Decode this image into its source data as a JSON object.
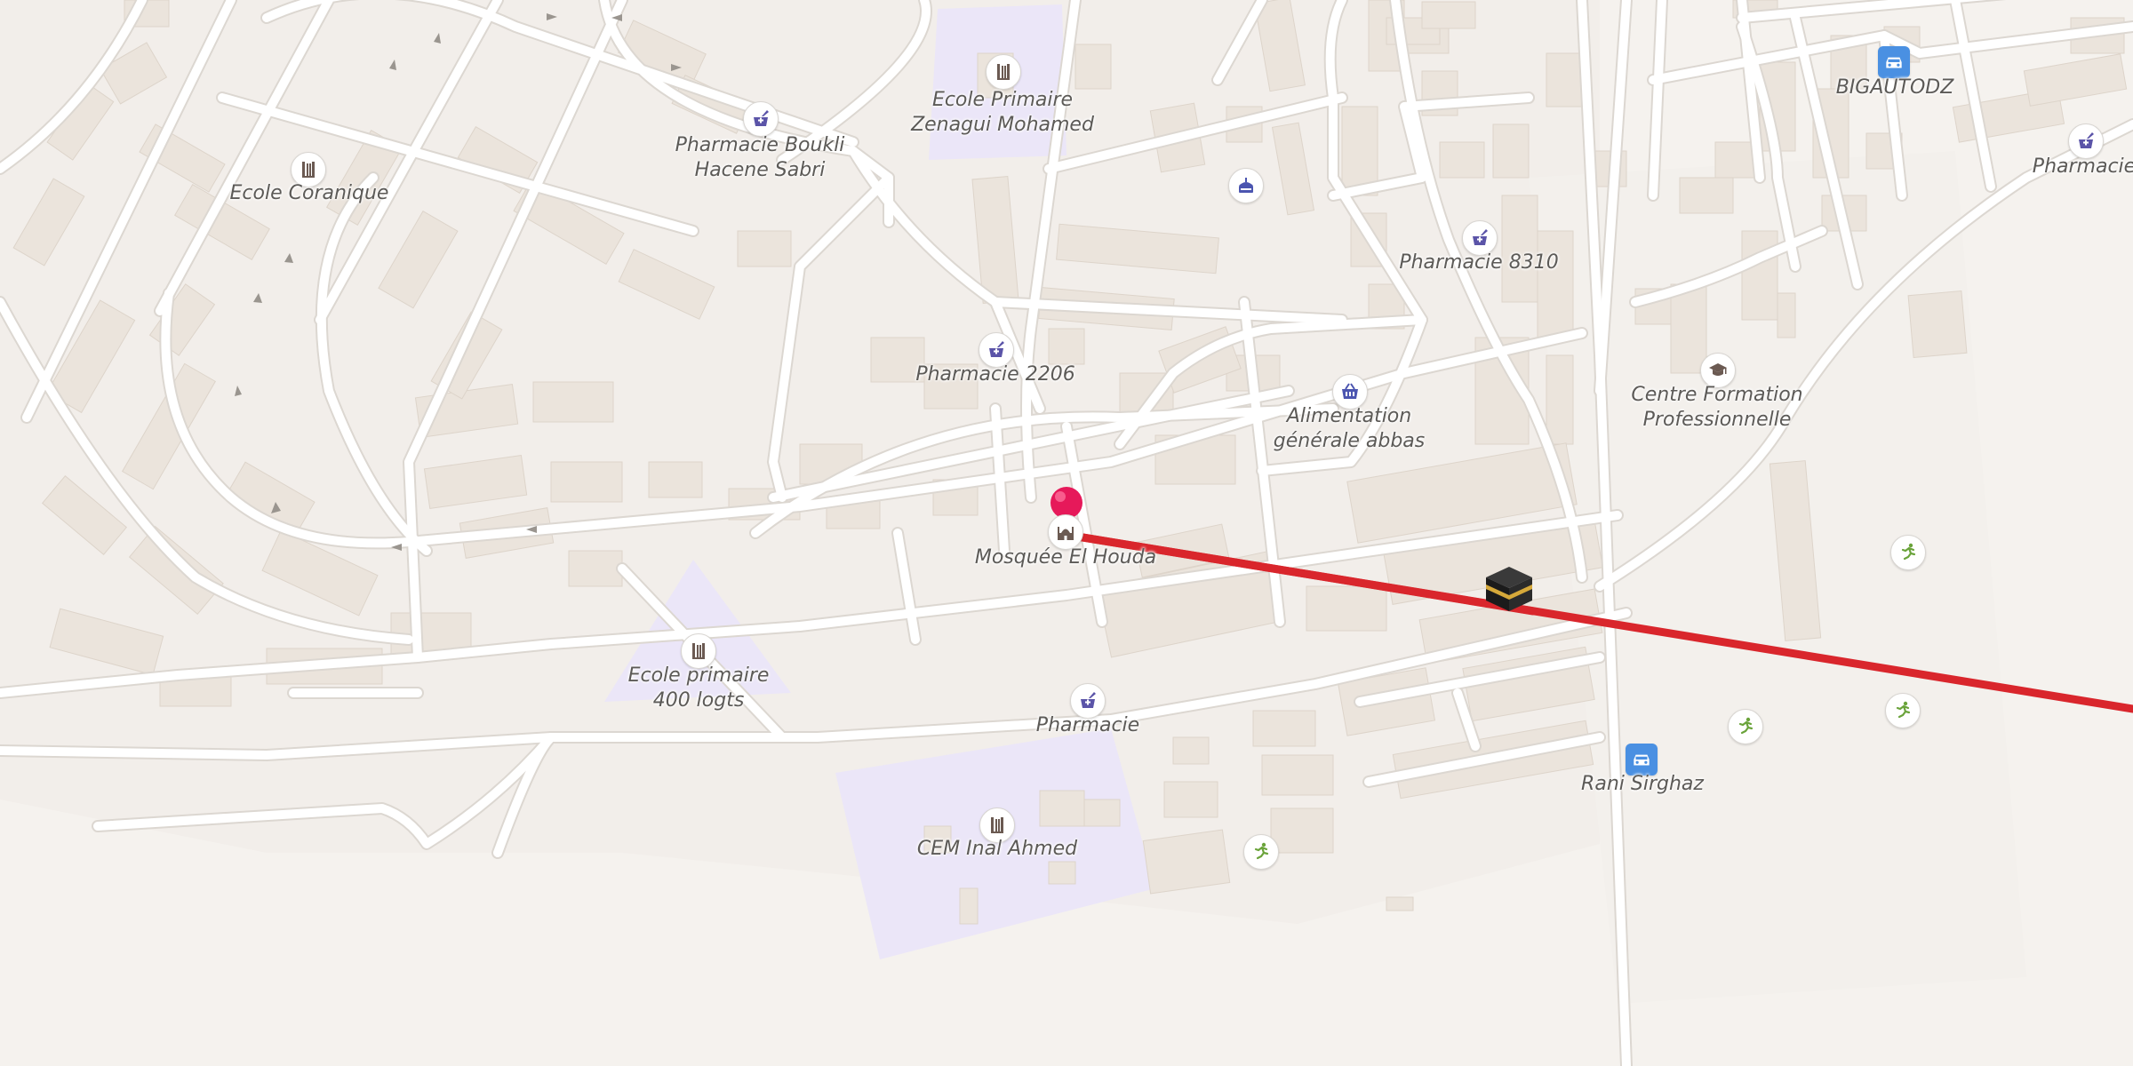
{
  "map": {
    "route_color": "#d9262c",
    "pin_color": "#e6195a",
    "education_area_color": "#ebe6f8",
    "building_color": "#ebe4dc",
    "road_color": "#ffffff",
    "road_casing_color": "#dcd7d1"
  },
  "labels": {
    "ecole_coranique": "Ecole Coranique",
    "pharmacie_boukli_1": "Pharmacie Boukli",
    "pharmacie_boukli_2": "Hacene Sabri",
    "ecole_primaire_zenagui_1": "Ecole Primaire",
    "ecole_primaire_zenagui_2": "Zenagui Mohamed",
    "pharmacie_8310": "Pharmacie 8310",
    "bigautodz": "BIGAUTODZ",
    "pharmacie_top_right": "Pharmacie",
    "pharmacie_2206": "Pharmacie 2206",
    "alimentation_1": "Alimentation",
    "alimentation_2": "générale abbas",
    "centre_formation_1": "Centre Formation",
    "centre_formation_2": "Professionnelle",
    "mosquee": "Mosquée El Houda",
    "ecole_400_1": "Ecole primaire",
    "ecole_400_2": "400 logts",
    "pharmacie_south": "Pharmacie",
    "rani_sirghaz": "Rani Sirghaz",
    "cem_inal": "CEM Inal Ahmed"
  },
  "icons": {
    "school": "school-icon",
    "pharmacy": "pharmacy-icon",
    "mosque": "mosque-icon",
    "shop": "shopping-basket-icon",
    "car": "car-service-icon",
    "graduation": "graduation-cap-icon",
    "sport": "sport-running-icon",
    "kaaba": "kaaba-icon",
    "pin": "location-pin-icon"
  }
}
